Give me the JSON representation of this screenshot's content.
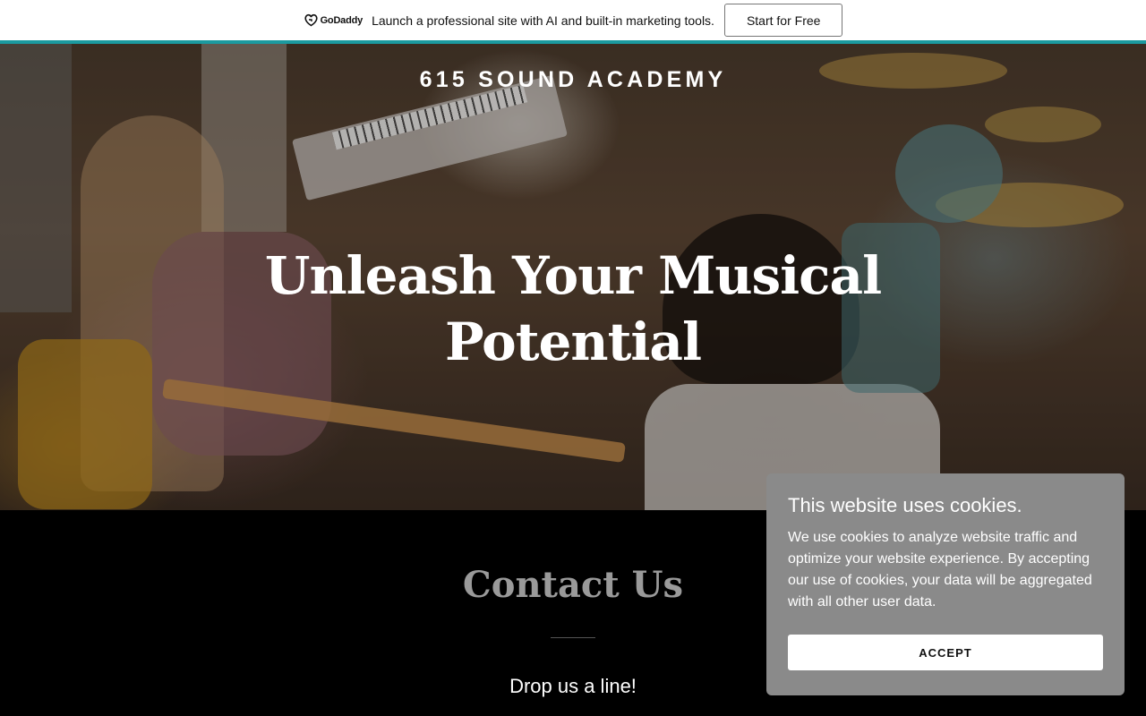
{
  "promo": {
    "logo_text": "GoDaddy",
    "message": "Launch a professional site with AI and built-in marketing tools.",
    "cta_label": "Start for Free",
    "accent_color": "#1b9aa0"
  },
  "hero": {
    "brand": "615 SOUND ACADEMY",
    "headline": "Unleash Your Musical Potential"
  },
  "contact": {
    "title": "Contact Us",
    "subtitle": "Drop us a line!"
  },
  "cookie_banner": {
    "title": "This website uses cookies.",
    "body": "We use cookies to analyze website traffic and optimize your website experience. By accepting our use of cookies, your data will be aggregated with all other user data.",
    "accept_label": "ACCEPT",
    "background_color": "#8a8a8a"
  }
}
